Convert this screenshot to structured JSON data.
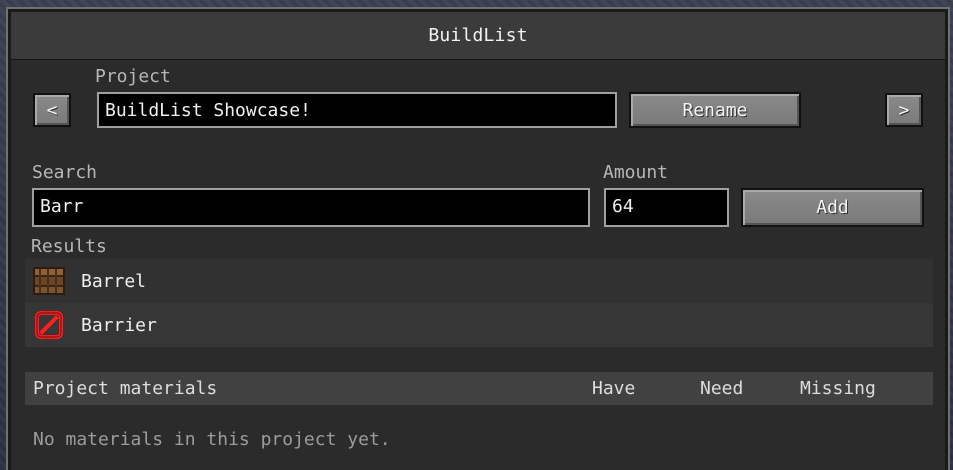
{
  "window": {
    "title": "BuildList"
  },
  "project": {
    "label": "Project",
    "name": "BuildList Showcase!",
    "rename_label": "Rename",
    "prev_label": "<",
    "next_label": ">"
  },
  "search": {
    "label": "Search",
    "value": "Barr"
  },
  "amount": {
    "label": "Amount",
    "value": "64"
  },
  "add": {
    "label": "Add"
  },
  "results": {
    "label": "Results",
    "items": [
      {
        "name": "Barrel",
        "icon": "barrel-icon"
      },
      {
        "name": "Barrier",
        "icon": "barrier-icon"
      }
    ]
  },
  "materials": {
    "columns": {
      "name": "Project materials",
      "have": "Have",
      "need": "Need",
      "missing": "Missing"
    },
    "empty_text": "No materials in this project yet."
  }
}
